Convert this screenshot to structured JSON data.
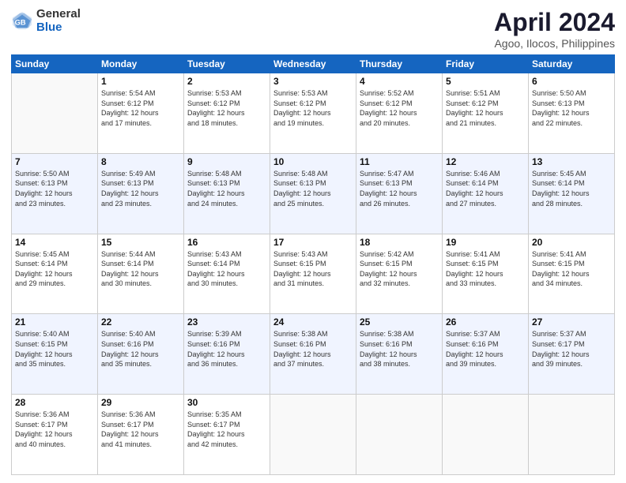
{
  "logo": {
    "general": "General",
    "blue": "Blue"
  },
  "title": "April 2024",
  "subtitle": "Agoo, Ilocos, Philippines",
  "weekdays": [
    "Sunday",
    "Monday",
    "Tuesday",
    "Wednesday",
    "Thursday",
    "Friday",
    "Saturday"
  ],
  "weeks": [
    [
      {
        "day": "",
        "info": ""
      },
      {
        "day": "1",
        "info": "Sunrise: 5:54 AM\nSunset: 6:12 PM\nDaylight: 12 hours\nand 17 minutes."
      },
      {
        "day": "2",
        "info": "Sunrise: 5:53 AM\nSunset: 6:12 PM\nDaylight: 12 hours\nand 18 minutes."
      },
      {
        "day": "3",
        "info": "Sunrise: 5:53 AM\nSunset: 6:12 PM\nDaylight: 12 hours\nand 19 minutes."
      },
      {
        "day": "4",
        "info": "Sunrise: 5:52 AM\nSunset: 6:12 PM\nDaylight: 12 hours\nand 20 minutes."
      },
      {
        "day": "5",
        "info": "Sunrise: 5:51 AM\nSunset: 6:12 PM\nDaylight: 12 hours\nand 21 minutes."
      },
      {
        "day": "6",
        "info": "Sunrise: 5:50 AM\nSunset: 6:13 PM\nDaylight: 12 hours\nand 22 minutes."
      }
    ],
    [
      {
        "day": "7",
        "info": "Sunrise: 5:50 AM\nSunset: 6:13 PM\nDaylight: 12 hours\nand 23 minutes."
      },
      {
        "day": "8",
        "info": "Sunrise: 5:49 AM\nSunset: 6:13 PM\nDaylight: 12 hours\nand 23 minutes."
      },
      {
        "day": "9",
        "info": "Sunrise: 5:48 AM\nSunset: 6:13 PM\nDaylight: 12 hours\nand 24 minutes."
      },
      {
        "day": "10",
        "info": "Sunrise: 5:48 AM\nSunset: 6:13 PM\nDaylight: 12 hours\nand 25 minutes."
      },
      {
        "day": "11",
        "info": "Sunrise: 5:47 AM\nSunset: 6:13 PM\nDaylight: 12 hours\nand 26 minutes."
      },
      {
        "day": "12",
        "info": "Sunrise: 5:46 AM\nSunset: 6:14 PM\nDaylight: 12 hours\nand 27 minutes."
      },
      {
        "day": "13",
        "info": "Sunrise: 5:45 AM\nSunset: 6:14 PM\nDaylight: 12 hours\nand 28 minutes."
      }
    ],
    [
      {
        "day": "14",
        "info": "Sunrise: 5:45 AM\nSunset: 6:14 PM\nDaylight: 12 hours\nand 29 minutes."
      },
      {
        "day": "15",
        "info": "Sunrise: 5:44 AM\nSunset: 6:14 PM\nDaylight: 12 hours\nand 30 minutes."
      },
      {
        "day": "16",
        "info": "Sunrise: 5:43 AM\nSunset: 6:14 PM\nDaylight: 12 hours\nand 30 minutes."
      },
      {
        "day": "17",
        "info": "Sunrise: 5:43 AM\nSunset: 6:15 PM\nDaylight: 12 hours\nand 31 minutes."
      },
      {
        "day": "18",
        "info": "Sunrise: 5:42 AM\nSunset: 6:15 PM\nDaylight: 12 hours\nand 32 minutes."
      },
      {
        "day": "19",
        "info": "Sunrise: 5:41 AM\nSunset: 6:15 PM\nDaylight: 12 hours\nand 33 minutes."
      },
      {
        "day": "20",
        "info": "Sunrise: 5:41 AM\nSunset: 6:15 PM\nDaylight: 12 hours\nand 34 minutes."
      }
    ],
    [
      {
        "day": "21",
        "info": "Sunrise: 5:40 AM\nSunset: 6:15 PM\nDaylight: 12 hours\nand 35 minutes."
      },
      {
        "day": "22",
        "info": "Sunrise: 5:40 AM\nSunset: 6:16 PM\nDaylight: 12 hours\nand 35 minutes."
      },
      {
        "day": "23",
        "info": "Sunrise: 5:39 AM\nSunset: 6:16 PM\nDaylight: 12 hours\nand 36 minutes."
      },
      {
        "day": "24",
        "info": "Sunrise: 5:38 AM\nSunset: 6:16 PM\nDaylight: 12 hours\nand 37 minutes."
      },
      {
        "day": "25",
        "info": "Sunrise: 5:38 AM\nSunset: 6:16 PM\nDaylight: 12 hours\nand 38 minutes."
      },
      {
        "day": "26",
        "info": "Sunrise: 5:37 AM\nSunset: 6:16 PM\nDaylight: 12 hours\nand 39 minutes."
      },
      {
        "day": "27",
        "info": "Sunrise: 5:37 AM\nSunset: 6:17 PM\nDaylight: 12 hours\nand 39 minutes."
      }
    ],
    [
      {
        "day": "28",
        "info": "Sunrise: 5:36 AM\nSunset: 6:17 PM\nDaylight: 12 hours\nand 40 minutes."
      },
      {
        "day": "29",
        "info": "Sunrise: 5:36 AM\nSunset: 6:17 PM\nDaylight: 12 hours\nand 41 minutes."
      },
      {
        "day": "30",
        "info": "Sunrise: 5:35 AM\nSunset: 6:17 PM\nDaylight: 12 hours\nand 42 minutes."
      },
      {
        "day": "",
        "info": ""
      },
      {
        "day": "",
        "info": ""
      },
      {
        "day": "",
        "info": ""
      },
      {
        "day": "",
        "info": ""
      }
    ]
  ]
}
